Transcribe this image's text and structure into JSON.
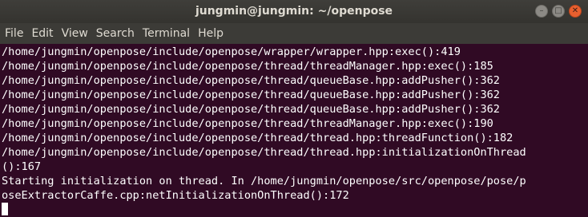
{
  "window": {
    "title": "jungmin@jungmin: ~/openpose"
  },
  "menubar": {
    "items": [
      "File",
      "Edit",
      "View",
      "Search",
      "Terminal",
      "Help"
    ]
  },
  "terminal": {
    "lines": [
      "/home/jungmin/openpose/include/openpose/wrapper/wrapper.hpp:exec():419",
      "/home/jungmin/openpose/include/openpose/thread/threadManager.hpp:exec():185",
      "/home/jungmin/openpose/include/openpose/thread/queueBase.hpp:addPusher():362",
      "/home/jungmin/openpose/include/openpose/thread/queueBase.hpp:addPusher():362",
      "/home/jungmin/openpose/include/openpose/thread/queueBase.hpp:addPusher():362",
      "/home/jungmin/openpose/include/openpose/thread/threadManager.hpp:exec():190",
      "/home/jungmin/openpose/include/openpose/thread/thread.hpp:threadFunction():182",
      "/home/jungmin/openpose/include/openpose/thread/thread.hpp:initializationOnThread",
      "():167",
      "Starting initialization on thread. In /home/jungmin/openpose/src/openpose/pose/p",
      "oseExtractorCaffe.cpp:netInitializationOnThread():172"
    ]
  },
  "colors": {
    "terminal_bg": "#300a24",
    "terminal_fg": "#ffffff",
    "close_button": "#e9602f"
  }
}
